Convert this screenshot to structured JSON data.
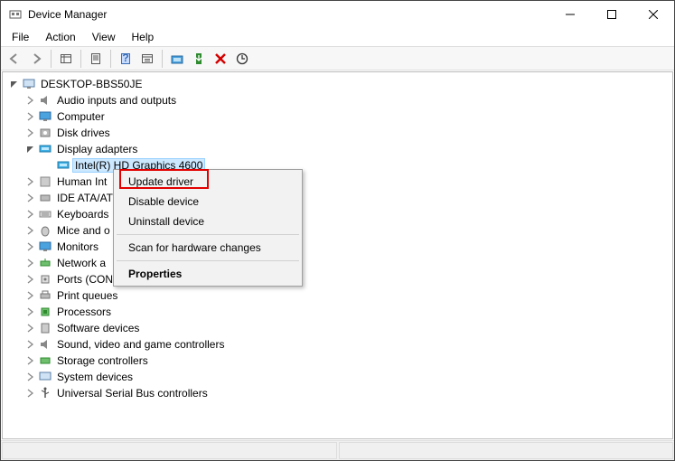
{
  "window": {
    "title": "Device Manager"
  },
  "menubar": {
    "file": "File",
    "action": "Action",
    "view": "View",
    "help": "Help"
  },
  "tree": {
    "root": "DESKTOP-BBS50JE",
    "nodes": {
      "audio": "Audio inputs and outputs",
      "computer": "Computer",
      "disk": "Disk drives",
      "display": "Display adapters",
      "gpu": "Intel(R) HD Graphics 4600",
      "hid": "Human Int",
      "ide": "IDE ATA/AT",
      "keyboards": "Keyboards",
      "mice": "Mice and o",
      "monitors": "Monitors",
      "network": "Network a",
      "ports": "Ports (CON",
      "printq": "Print queues",
      "processors": "Processors",
      "software": "Software devices",
      "sound": "Sound, video and game controllers",
      "storage": "Storage controllers",
      "system": "System devices",
      "usb": "Universal Serial Bus controllers"
    }
  },
  "context_menu": {
    "update": "Update driver",
    "disable": "Disable device",
    "uninstall": "Uninstall device",
    "scan": "Scan for hardware changes",
    "properties": "Properties"
  }
}
